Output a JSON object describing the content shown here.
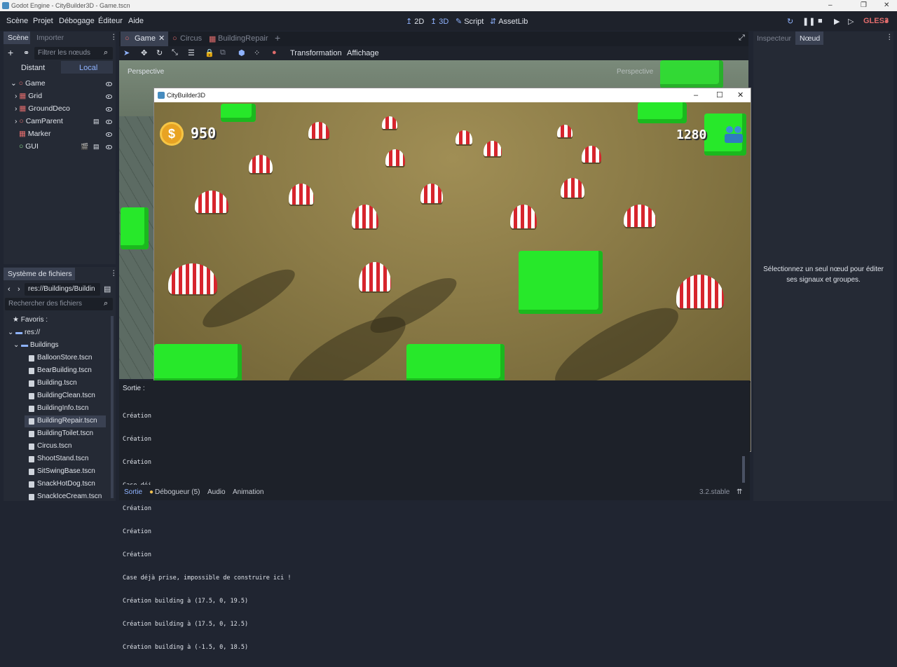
{
  "window": {
    "title": "Godot Engine - CityBuilder3D - Game.tscn",
    "controls": [
      "–",
      "❐",
      "✕"
    ]
  },
  "menu": {
    "items": [
      "Scène",
      "Projet",
      "Débogage",
      "Éditeur",
      "Aide"
    ]
  },
  "toolbar": {
    "btn_2d": "2D",
    "btn_3d": "3D",
    "btn_script": "Script",
    "btn_assetlib": "AssetLib",
    "renderer": "GLES3"
  },
  "scene_dock": {
    "tab_scene": "Scène",
    "tab_import": "Importer",
    "filter_placeholder": "Filtrer les nœuds",
    "remote": "Distant",
    "local": "Local",
    "nodes": [
      "Game",
      "Grid",
      "GroundDeco",
      "CamParent",
      "Marker",
      "GUI"
    ]
  },
  "scene_tabs": [
    "Game",
    "Circus",
    "BuildingRepair"
  ],
  "viewport_toolbar": {
    "transform": "Transformation",
    "view": "Affichage",
    "perspective": "Perspective",
    "perspective2": "Perspective"
  },
  "game_window": {
    "title": "CityBuilder3D",
    "money": "950",
    "population": "1280",
    "coin_symbol": "$"
  },
  "filesystem": {
    "tab": "Système de fichiers",
    "path": "res://Buildings/Buildin",
    "search_placeholder": "Rechercher des fichiers",
    "favorites": "Favoris :",
    "root": "res://",
    "folder": "Buildings",
    "files": [
      "BalloonStore.tscn",
      "BearBuilding.tscn",
      "Building.tscn",
      "BuildingClean.tscn",
      "BuildingInfo.tscn",
      "BuildingRepair.tscn",
      "BuildingToilet.tscn",
      "Circus.tscn",
      "ShootStand.tscn",
      "SitSwingBase.tscn",
      "SnackHotDog.tscn",
      "SnackIceCream.tscn"
    ]
  },
  "inspector": {
    "tab_inspector": "Inspecteur",
    "tab_node": "Nœud",
    "message": "Sélectionnez un seul nœud pour éditer ses signaux et groupes."
  },
  "output": {
    "label": "Sortie :",
    "lines": [
      "Création",
      "Création",
      "Création",
      "Case déj",
      "Création",
      "Création",
      "Création",
      "Case déjà prise, impossible de construire ici !",
      "Création building à (17.5, 0, 19.5)",
      "Création building à (17.5, 0, 12.5)",
      "Création building à (-1.5, 0, 18.5)"
    ]
  },
  "bottom_tabs": {
    "output": "Sortie",
    "debugger": "Débogueur (5)",
    "audio": "Audio",
    "animation": "Animation",
    "version": "3.2.stable"
  },
  "colors": {
    "accent": "#478cbf",
    "editor_bg": "#202531",
    "dock_bg": "#252a35",
    "tent_red": "#d6252d",
    "tree_green": "#27e82a"
  }
}
